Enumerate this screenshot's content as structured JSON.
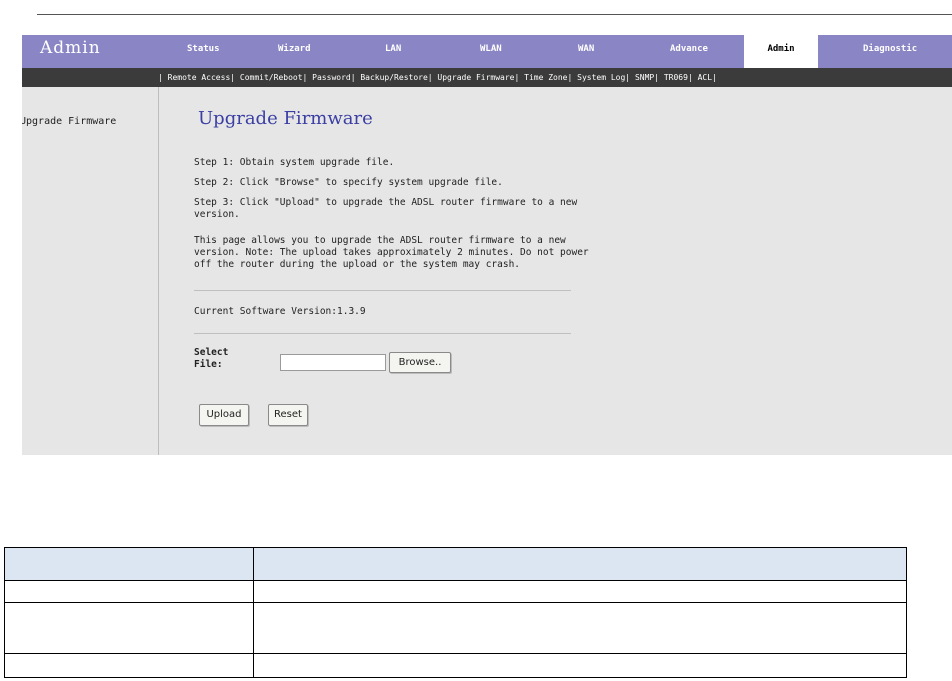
{
  "nav": {
    "brand": "Admin",
    "tabs": [
      {
        "label": "Status",
        "active": false
      },
      {
        "label": "Wizard",
        "active": false
      },
      {
        "label": "LAN",
        "active": false
      },
      {
        "label": "WLAN",
        "active": false
      },
      {
        "label": "WAN",
        "active": false
      },
      {
        "label": "Advance",
        "active": false
      },
      {
        "label": "Admin",
        "active": true
      },
      {
        "label": "Diagnostic",
        "active": false
      }
    ],
    "colors": {
      "bar": "#8a86c6",
      "subbar": "#3b3b3b",
      "title": "#3b3fa4"
    }
  },
  "subnav": {
    "items": [
      "Remote Access",
      "Commit/Reboot",
      "Password",
      "Backup/Restore",
      "Upgrade Firmware",
      "Time Zone",
      "System Log",
      "SNMP",
      "TR069",
      "ACL"
    ]
  },
  "sidebar": {
    "items": [
      "Upgrade Firmware"
    ]
  },
  "main": {
    "title": "Upgrade Firmware",
    "step1": "Step 1: Obtain system upgrade file.",
    "step2": "Step 2: Click \"Browse\" to specify system upgrade file.",
    "step3": "Step 3: Click \"Upload\" to upgrade the ADSL router firmware to a new version.",
    "note": "This page allows you to upgrade the ADSL router firmware to a new version. Note: The upload takes approximately 2 minutes. Do not power off the router during the upload or the system may crash.",
    "version_label": "Current Software Version:",
    "version_value": "1.3.9",
    "select_label": "Select File:",
    "file_value": "",
    "browse_label": "Browse..",
    "upload_label": "Upload",
    "reset_label": "Reset"
  },
  "table": {
    "rows": [
      [
        "",
        ""
      ],
      [
        "",
        ""
      ],
      [
        "",
        ""
      ],
      [
        "",
        ""
      ]
    ]
  }
}
